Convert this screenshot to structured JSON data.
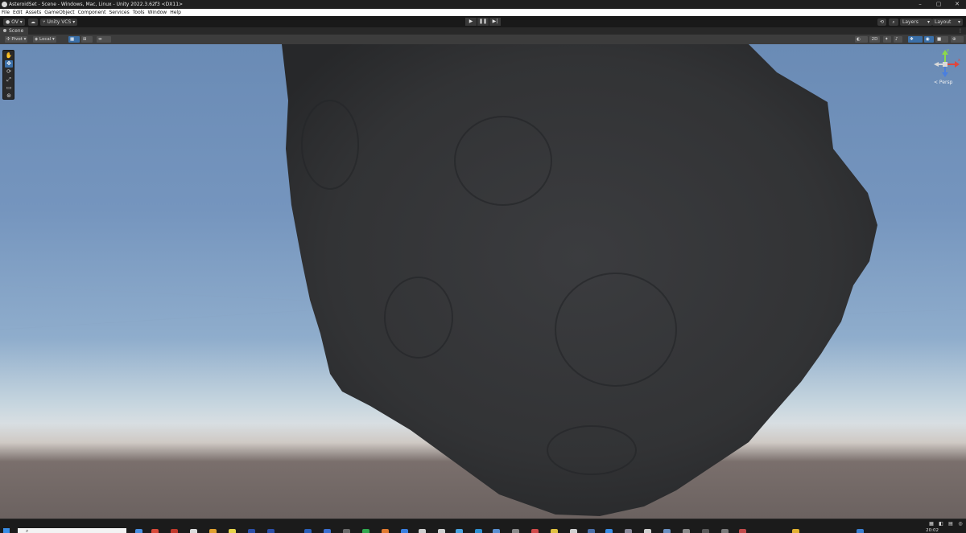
{
  "window": {
    "title": "AsteroidSet - Scene - Windows, Mac, Linux - Unity 2022.3.62f3 <DX11>",
    "controls": [
      "–",
      "▢",
      "✕"
    ]
  },
  "menu": [
    "File",
    "Edit",
    "Assets",
    "GameObject",
    "Component",
    "Services",
    "Tools",
    "Window",
    "Help"
  ],
  "toolbar": {
    "account_label": "OV ▾",
    "vcs_label": "Unity VCS ▾",
    "layers_label": "Layers",
    "layout_label": "Layout"
  },
  "scene_tab": {
    "label": "Scene"
  },
  "scene_toolbar": {
    "pivot_label": "Pivot ▾",
    "local_label": "Local ▾",
    "mode_2d_label": "2D"
  },
  "gizmo": {
    "view_label": "< Persp",
    "axis_y_label": "y",
    "axis_x_label": "x",
    "axis_colors": {
      "x": "#e0463c",
      "y": "#8cd94a",
      "z": "#4a7fe0"
    }
  },
  "taskbar": {
    "clock": "20:02"
  },
  "colors": {
    "sky_top": "#6a8bb5",
    "horizon": "#d8dee2",
    "ground": "#6b6260",
    "asteroid": "#333436",
    "accent": "#3a6fa8"
  }
}
